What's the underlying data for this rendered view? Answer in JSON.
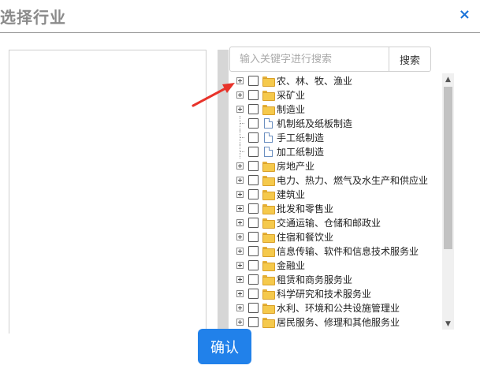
{
  "dialog": {
    "title": "选择行业",
    "close_label": "×"
  },
  "search": {
    "placeholder": "输入关键字进行搜索",
    "value": "",
    "button_label": "搜索"
  },
  "tree": {
    "nodes": [
      {
        "label": "农、林、牧、渔业",
        "type": "folder",
        "expandable": true,
        "checked": false
      },
      {
        "label": "采矿业",
        "type": "folder",
        "expandable": true,
        "checked": false
      },
      {
        "label": "制造业",
        "type": "folder",
        "expandable": true,
        "checked": false
      },
      {
        "label": "机制纸及纸板制造",
        "type": "file",
        "expandable": false,
        "checked": false
      },
      {
        "label": "手工纸制造",
        "type": "file",
        "expandable": false,
        "checked": false
      },
      {
        "label": "加工纸制造",
        "type": "file",
        "expandable": false,
        "checked": false
      },
      {
        "label": "房地产业",
        "type": "folder",
        "expandable": true,
        "checked": false
      },
      {
        "label": "电力、热力、燃气及水生产和供应业",
        "type": "folder",
        "expandable": true,
        "checked": false
      },
      {
        "label": "建筑业",
        "type": "folder",
        "expandable": true,
        "checked": false
      },
      {
        "label": "批发和零售业",
        "type": "folder",
        "expandable": true,
        "checked": false
      },
      {
        "label": "交通运输、仓储和邮政业",
        "type": "folder",
        "expandable": true,
        "checked": false
      },
      {
        "label": "住宿和餐饮业",
        "type": "folder",
        "expandable": true,
        "checked": false
      },
      {
        "label": "信息传输、软件和信息技术服务业",
        "type": "folder",
        "expandable": true,
        "checked": false
      },
      {
        "label": "金融业",
        "type": "folder",
        "expandable": true,
        "checked": false
      },
      {
        "label": "租赁和商务服务业",
        "type": "folder",
        "expandable": true,
        "checked": false
      },
      {
        "label": "科学研究和技术服务业",
        "type": "folder",
        "expandable": true,
        "checked": false
      },
      {
        "label": "水利、环境和公共设施管理业",
        "type": "folder",
        "expandable": true,
        "checked": false
      },
      {
        "label": "居民服务、修理和其他服务业",
        "type": "folder",
        "expandable": true,
        "checked": false
      }
    ]
  },
  "scrollbar": {
    "up_icon": "▲",
    "down_icon": "▼"
  },
  "footer": {
    "confirm_label": "确认"
  },
  "colors": {
    "accent": "#2181ea",
    "close": "#1a73d9",
    "annotation_arrow": "#e8332a",
    "folder": "#f5c94c"
  }
}
